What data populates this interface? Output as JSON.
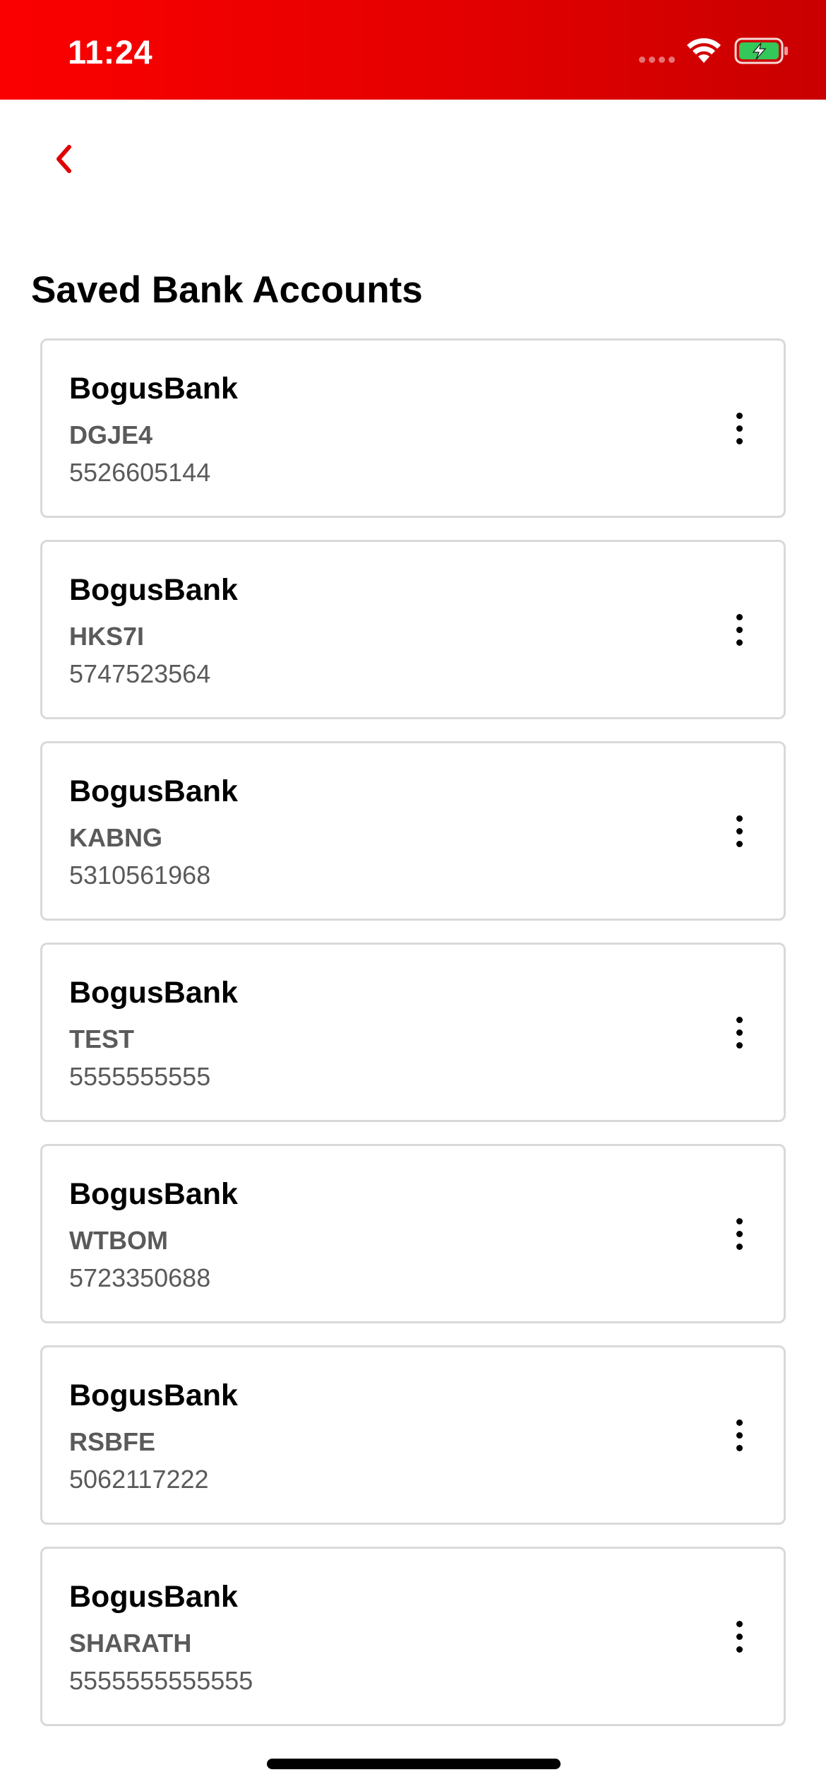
{
  "status_bar": {
    "time": "11:24",
    "icons": [
      "cellular-signal-icon",
      "wifi-icon",
      "battery-charging-icon"
    ]
  },
  "header": {
    "back_icon": "chevron-left-icon",
    "title": "Saved Bank Accounts"
  },
  "colors": {
    "brand_red": "#e40000",
    "text_primary": "#000000",
    "text_secondary": "#5a5a5a",
    "card_border": "#d9d9d9",
    "battery_green": "#34c759"
  },
  "accounts": [
    {
      "bank": "BogusBank",
      "nickname": "DGJE4",
      "number": "5526605144",
      "menu_icon": "more-vertical-icon"
    },
    {
      "bank": "BogusBank",
      "nickname": "HKS7I",
      "number": "5747523564",
      "menu_icon": "more-vertical-icon"
    },
    {
      "bank": "BogusBank",
      "nickname": "KABNG",
      "number": "5310561968",
      "menu_icon": "more-vertical-icon"
    },
    {
      "bank": "BogusBank",
      "nickname": "TEST",
      "number": "5555555555",
      "menu_icon": "more-vertical-icon"
    },
    {
      "bank": "BogusBank",
      "nickname": "WTBOM",
      "number": "5723350688",
      "menu_icon": "more-vertical-icon"
    },
    {
      "bank": "BogusBank",
      "nickname": "RSBFE",
      "number": "5062117222",
      "menu_icon": "more-vertical-icon"
    },
    {
      "bank": "BogusBank",
      "nickname": "SHARATH",
      "number": "5555555555555",
      "menu_icon": "more-vertical-icon"
    }
  ]
}
